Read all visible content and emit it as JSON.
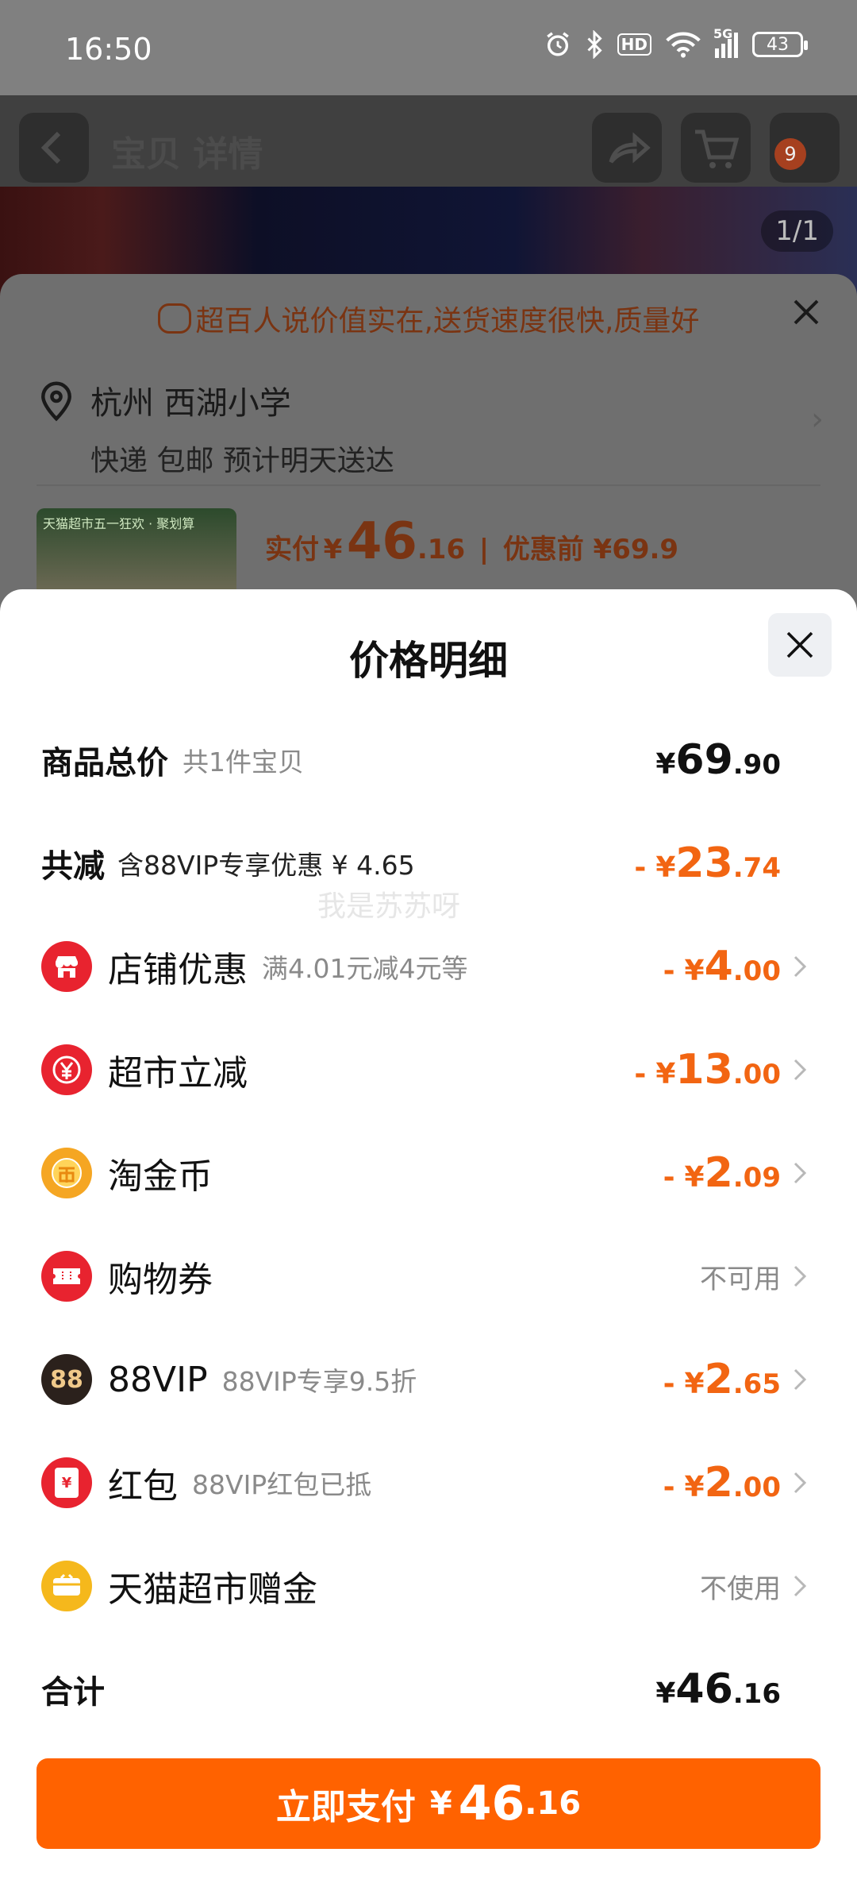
{
  "status_bar": {
    "time": "16:50",
    "network": "5G",
    "hd_label": "HD",
    "battery": "43"
  },
  "background": {
    "header_title": "宝贝 详情",
    "cart_badge": "9",
    "image_pager": "1/1",
    "tip_banner": "超百人说价值实在,送货速度很快,质量好",
    "address_line": "杭州 西湖小学",
    "delivery_line": "快递 包邮 预计明天送达",
    "thumb_tag": "天猫超市五一狂欢 · 聚划算",
    "paid_label": "实付",
    "paid_symbol": "¥",
    "paid_int": "46",
    "paid_dec": ".16",
    "before_discount": "优惠前 ¥69.9"
  },
  "sheet": {
    "title": "价格明细",
    "watermark": "我是苏苏呀",
    "rows": {
      "total_goods": {
        "label": "商品总价",
        "sub": "共1件宝贝",
        "symbol": "¥",
        "int": "69",
        "dec": ".90"
      },
      "total_reduce": {
        "label": "共减",
        "sub": "含88VIP专享优惠 ¥ 4.65",
        "minus": "-",
        "symbol": "¥",
        "int": "23",
        "dec": ".74"
      },
      "shop": {
        "label": "店铺优惠",
        "sub": "满4.01元减4元等",
        "minus": "-",
        "symbol": "¥",
        "int": "4",
        "dec": ".00",
        "icon": "shop-icon",
        "color": "#e8232f"
      },
      "market": {
        "label": "超市立减",
        "minus": "-",
        "symbol": "¥",
        "int": "13",
        "dec": ".00",
        "icon": "yuan-coupon-icon",
        "color": "#e8232f"
      },
      "coin": {
        "label": "淘金币",
        "minus": "-",
        "symbol": "¥",
        "int": "2",
        "dec": ".09",
        "icon": "gold-coin-icon",
        "color": "#f5a623"
      },
      "voucher": {
        "label": "购物券",
        "status": "不可用",
        "icon": "ticket-icon",
        "color": "#e8232f"
      },
      "vip": {
        "label": "88VIP",
        "sub": "88VIP专享9.5折",
        "minus": "-",
        "symbol": "¥",
        "int": "2",
        "dec": ".65",
        "icon": "88vip-icon",
        "icon_text": "88",
        "color": "#2b211c"
      },
      "redpacket": {
        "label": "红包",
        "sub": "88VIP红包已抵",
        "minus": "-",
        "symbol": "¥",
        "int": "2",
        "dec": ".00",
        "icon": "red-packet-icon",
        "icon_text": "¥",
        "color": "#e8232f"
      },
      "gift": {
        "label": "天猫超市赠金",
        "status": "不使用",
        "icon": "gift-card-icon",
        "color": "#f5b81c"
      },
      "sum": {
        "label": "合计",
        "symbol": "¥",
        "int": "46",
        "dec": ".16"
      }
    },
    "pay_button": {
      "label": "立即支付",
      "symbol": "¥",
      "int": "46",
      "dec": ".16",
      "color": "#ff6200"
    }
  },
  "colors": {
    "accent_orange": "#f26512",
    "button_orange": "#ff6200"
  }
}
